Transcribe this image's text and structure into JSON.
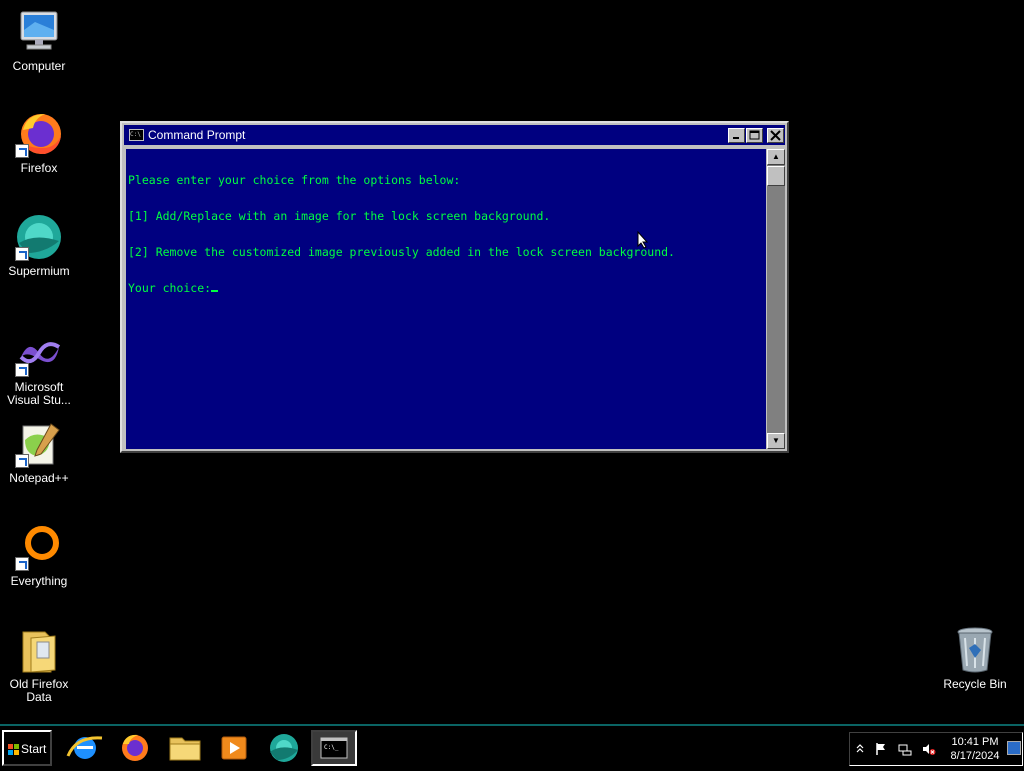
{
  "desktop": {
    "icons": [
      {
        "label": "Computer"
      },
      {
        "label": "Firefox"
      },
      {
        "label": "Supermium"
      },
      {
        "label": "Microsoft Visual Stu..."
      },
      {
        "label": "Notepad++"
      },
      {
        "label": "Everything"
      },
      {
        "label": "Old Firefox Data"
      },
      {
        "label": "Recycle Bin"
      }
    ]
  },
  "cmd": {
    "title": "Command Prompt",
    "title_icon_text": "C:\\",
    "lines": [
      "Please enter your choice from the options below:",
      "[1] Add/Replace with an image for the lock screen background.",
      "[2] Remove the customized image previously added in the lock screen background.",
      "Your choice:"
    ],
    "colors": {
      "background": "#000080",
      "text": "#00ff40"
    }
  },
  "taskbar": {
    "start_label": "Start",
    "apps": [
      "internet-explorer",
      "firefox",
      "file-explorer",
      "media-player",
      "supermium",
      "command-prompt"
    ],
    "clock": {
      "time": "10:41 PM",
      "date": "8/17/2024"
    }
  }
}
